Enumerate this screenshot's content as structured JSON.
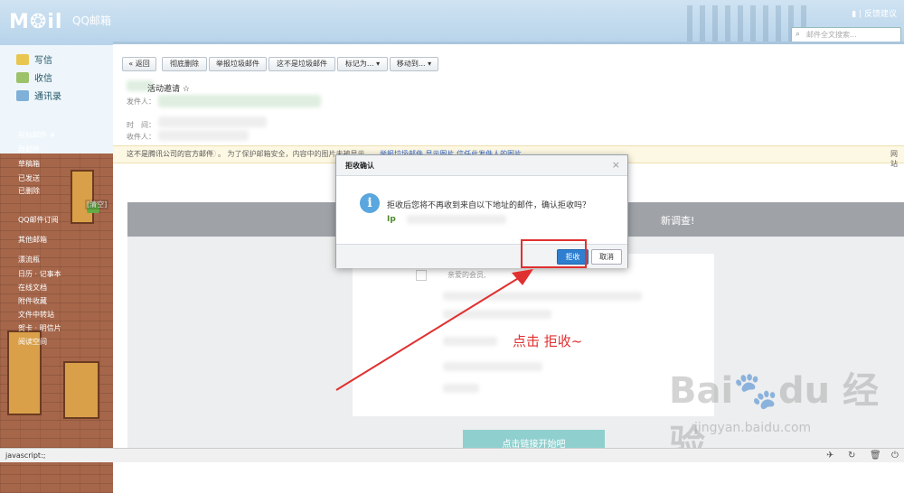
{
  "header": {
    "logo_text": "M❂il",
    "logo_sub": "QQ邮箱",
    "feedback": "反馈建议",
    "search_placeholder": "邮件全文搜索..."
  },
  "sidebar": {
    "primary": [
      {
        "label": "写信",
        "icon": "pencil-icon"
      },
      {
        "label": "收信",
        "icon": "inbox-icon"
      },
      {
        "label": "通讯录",
        "icon": "contacts-icon"
      }
    ],
    "secondary": [
      "星标邮件 ★",
      "群邮件",
      "草稿箱",
      "已发送",
      "已删除",
      "QQ邮件订阅",
      "其他邮箱",
      "漂流瓶",
      "日历  ·  记事本",
      "在线文档",
      "附件收藏",
      "文件中转站",
      "贺卡  ·  明信片",
      "阅读空间"
    ],
    "clear_label": "[清空]"
  },
  "toolbar": {
    "buttons": [
      "« 返回",
      "彻底删除",
      "举报垃圾邮件",
      "这不是垃圾邮件",
      "标记为... ▾",
      "移动到... ▾"
    ]
  },
  "email": {
    "subject": "活动邀请 ☆",
    "sender_label": "发件人：",
    "time_label": "时　间：",
    "recipient_label": "收件人：",
    "warning_main": "这不是腾讯公司的官方邮件",
    "warning_rest": "。 为了保护邮箱安全，内容中的图片未被显示。",
    "warning_links": "举报垃圾邮件  显示图片   信任此发件人的图片",
    "warning_right": "网站",
    "survey_title": "新调查!",
    "greeting": "亲爱的会员,",
    "start_button": "点击链接开始吧"
  },
  "dialog": {
    "title": "拒收确认",
    "message": "拒收后您将不再收到来自以下地址的邮件，确认拒收吗？",
    "address": "Ip",
    "reject_label": "拒收",
    "cancel_label": "取消"
  },
  "annotation": {
    "text": "点击 拒收~",
    "color": "#e03030"
  },
  "watermark": {
    "brand": "Bai🐾du 经验",
    "url": "jingyan.baidu.com"
  },
  "status_bar": {
    "text": "javascript:;"
  }
}
